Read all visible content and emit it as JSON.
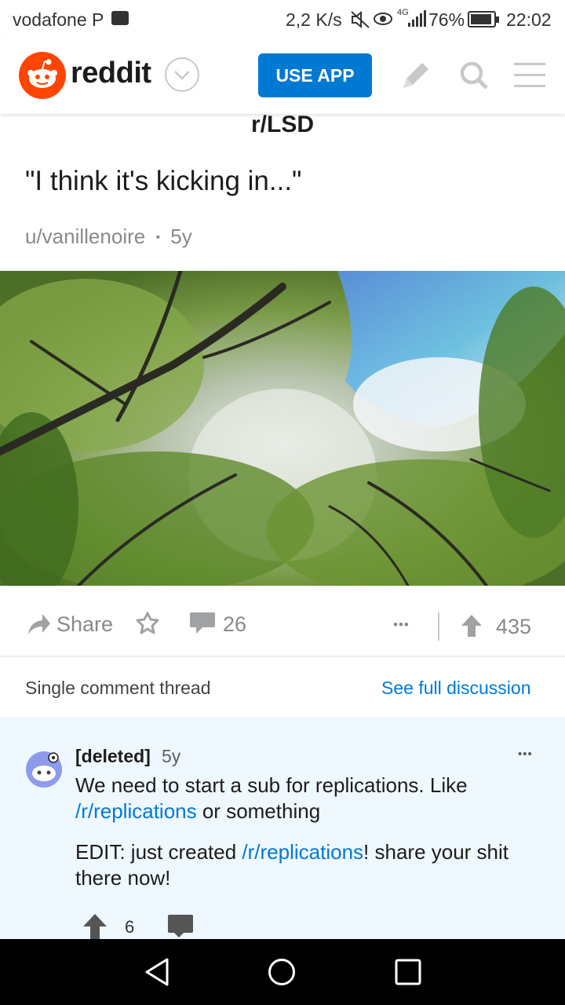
{
  "status_bar": {
    "carrier": "vodafone P",
    "speed": "2,2 K/s",
    "network": "4G",
    "battery": "76%",
    "time": "22:02"
  },
  "header": {
    "logo_text": "reddit",
    "use_app_label": "USE APP",
    "icons": [
      "chevron-down-icon",
      "pencil-icon",
      "search-icon",
      "menu-icon"
    ]
  },
  "post": {
    "subreddit": "r/LSD",
    "title": "\"I think it's kicking in...\"",
    "author": "u/vanillenoire",
    "separator": "•",
    "age": "5y",
    "share_label": "Share",
    "comment_count": "26",
    "more_label": "•••",
    "score": "435"
  },
  "thread_bar": {
    "label": "Single comment thread",
    "link": "See full discussion"
  },
  "comment": {
    "author": "[deleted]",
    "age": "5y",
    "more_label": "•••",
    "line1_pre": "We need to start a sub for replications. Like",
    "line1_link": "/r/replications",
    "line1_post": " or something",
    "line2_pre": "EDIT: just created ",
    "line2_link": "/r/replications",
    "line2_post": "! share your shit there now!",
    "score": "6"
  },
  "colors": {
    "reddit_orange": "#ff4500",
    "accent_blue": "#0079d3",
    "comment_bg": "#eff7ff",
    "muted": "#878a8c"
  }
}
